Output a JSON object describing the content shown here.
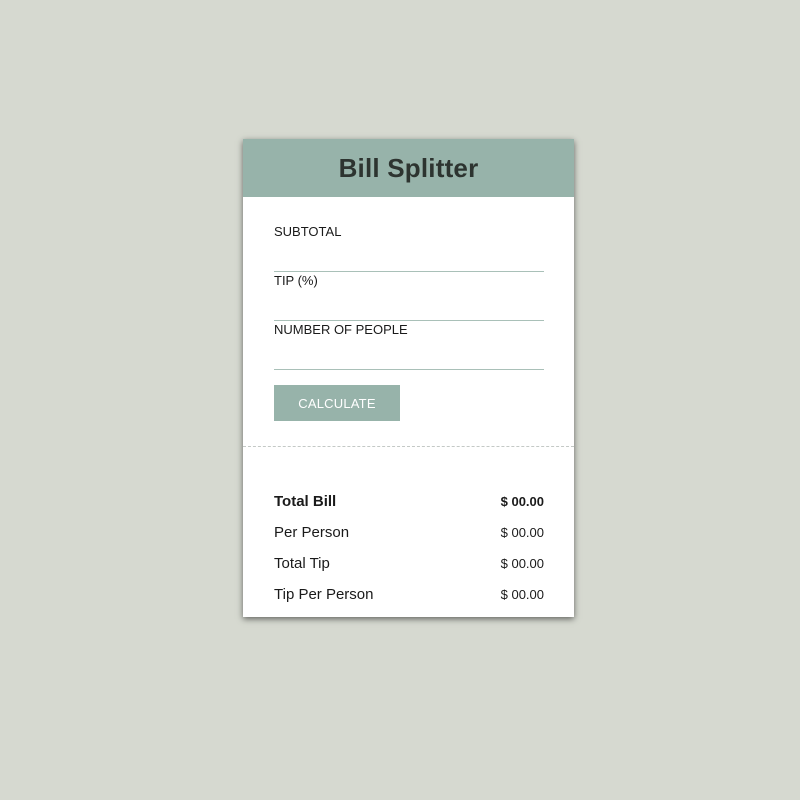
{
  "app": {
    "title": "Bill Splitter"
  },
  "form": {
    "subtotal_label": "SUBTOTAL",
    "subtotal_value": "",
    "tip_label": "TIP (%)",
    "tip_value": "",
    "people_label": "NUMBER OF PEOPLE",
    "people_value": "",
    "calculate_label": "CALCULATE"
  },
  "results": {
    "total_bill_label": "Total Bill",
    "total_bill_value": "$ 00.00",
    "per_person_label": "Per Person",
    "per_person_value": "$ 00.00",
    "total_tip_label": "Total Tip",
    "total_tip_value": "$ 00.00",
    "tip_per_person_label": "Tip Per Person",
    "tip_per_person_value": "$ 00.00"
  },
  "colors": {
    "background": "#d6d9d0",
    "accent": "#97b3aa",
    "title_text": "#2d3430",
    "card": "#ffffff"
  }
}
